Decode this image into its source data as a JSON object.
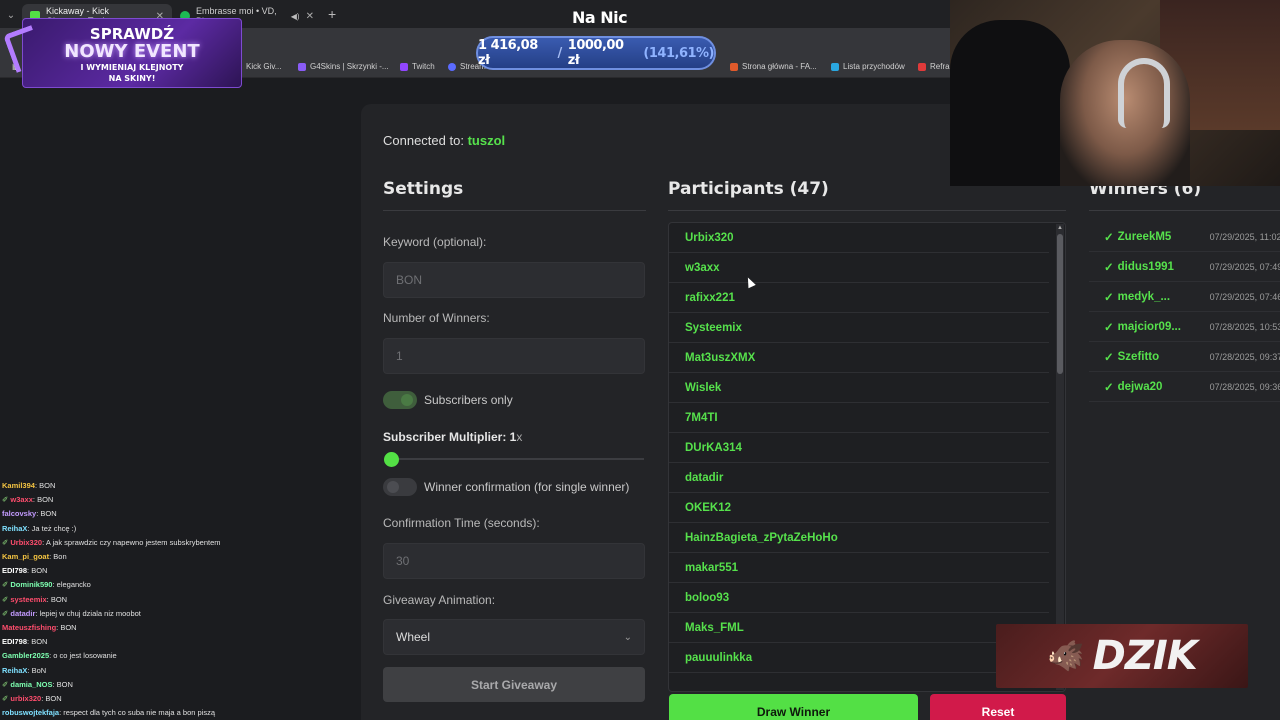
{
  "browser": {
    "tabs": [
      {
        "title": "Kickaway - Kick Giveaway Tool",
        "active": true,
        "color": "#53e045"
      },
      {
        "title": "Embrasse moi • VD, Bleue",
        "active": false,
        "color": "#1db954"
      }
    ],
    "bookmarks": [
      {
        "label": "Kick Giv..."
      },
      {
        "label": "G4Skins | Skrzynki -..."
      },
      {
        "label": "Twitch"
      },
      {
        "label": "Stream"
      },
      {
        "label": "Strona główna - FA..."
      },
      {
        "label": "Lista przychodów"
      },
      {
        "label": "Refra"
      }
    ]
  },
  "overlay": {
    "channel_title": "Na Nic",
    "promo": {
      "line1": "SPRAWDŹ",
      "line2": "NOWY EVENT",
      "line3": "I WYMIENIAJ KLEJNOTY",
      "line4": "NA SKINY!"
    },
    "money": {
      "current": "1 416,08 zł",
      "separator": "/",
      "goal": "1000,00 zł",
      "percent": "(141,61%)"
    },
    "sponsor": "DZIK"
  },
  "app": {
    "connected_label": "Connected to:",
    "connected_user": "tuszol",
    "settings": {
      "title": "Settings",
      "keyword_label": "Keyword (optional):",
      "keyword_placeholder": "BON",
      "winners_label": "Number of Winners:",
      "winners_placeholder": "1",
      "subscribers_only_label": "Subscribers only",
      "subscribers_only": true,
      "multiplier_label": "Subscriber Multiplier: 1",
      "multiplier_suffix": "x",
      "multiplier_value": 1,
      "winner_confirmation_label": "Winner confirmation (for single winner)",
      "winner_confirmation": false,
      "confirmation_time_label": "Confirmation Time (seconds):",
      "confirmation_time_placeholder": "30",
      "animation_label": "Giveaway Animation:",
      "animation_value": "Wheel",
      "start_button": "Start Giveaway"
    },
    "participants": {
      "title": "Participants (47)",
      "items": [
        "Urbix320",
        "w3axx",
        "rafixx221",
        "Systeemix",
        "Mat3uszXMX",
        "Wislek",
        "7M4TI",
        "DUrKA314",
        "datadir",
        "OKEK12",
        "HainzBagieta_zPytaZeHoHo",
        "makar551",
        "boloo93",
        "Maks_FML",
        "pauuulinkka"
      ],
      "draw_button": "Draw Winner",
      "reset_button": "Reset"
    },
    "winners": {
      "title": "Winners (6)",
      "items": [
        {
          "name": "ZureekM5",
          "time": "07/29/2025, 11:02"
        },
        {
          "name": "didus1991",
          "time": "07/29/2025, 07:49"
        },
        {
          "name": "medyk_...",
          "time": "07/29/2025, 07:46"
        },
        {
          "name": "majcior09...",
          "time": "07/28/2025, 10:53"
        },
        {
          "name": "Szefitto",
          "time": "07/28/2025, 09:37"
        },
        {
          "name": "dejwa20",
          "time": "07/28/2025, 09:36"
        }
      ],
      "check": "✓"
    }
  },
  "chat": [
    {
      "user": "Kamil394",
      "color": "#f5c542",
      "msg": "BON",
      "icon": false
    },
    {
      "user": "w3axx",
      "color": "#ff4d6d",
      "msg": "BON",
      "icon": true
    },
    {
      "user": "falcovsky",
      "color": "#c39bff",
      "msg": "BON",
      "icon": false
    },
    {
      "user": "ReihaX",
      "color": "#7fe0ff",
      "msg": "Ja też chcę :)",
      "icon": false
    },
    {
      "user": "Urbix320",
      "color": "#ff4d6d",
      "msg": "A jak sprawdzic czy napewno jestem subskrybentem",
      "icon": true
    },
    {
      "user": "Kam_pi_goat",
      "color": "#f5c542",
      "msg": "Bon",
      "icon": false
    },
    {
      "user": "EDI798",
      "color": "#ffffff",
      "msg": "BON",
      "icon": false
    },
    {
      "user": "Dominik590",
      "color": "#7dffb0",
      "msg": "elegancko",
      "icon": true
    },
    {
      "user": "systeemix",
      "color": "#ff4d6d",
      "msg": "BON",
      "icon": true
    },
    {
      "user": "datadir",
      "color": "#c39bff",
      "msg": "lepiej w chuj dziala niz moobot",
      "icon": true
    },
    {
      "user": "Mateuszfishing",
      "color": "#ff4d6d",
      "msg": "BON",
      "icon": false
    },
    {
      "user": "EDI798",
      "color": "#ffffff",
      "msg": "BON",
      "icon": false
    },
    {
      "user": "Gambler2025",
      "color": "#7dffb0",
      "msg": "o co jest losowanie",
      "icon": false
    },
    {
      "user": "ReihaX",
      "color": "#7fe0ff",
      "msg": "BoN",
      "icon": false
    },
    {
      "user": "damia_NOS",
      "color": "#7dffb0",
      "msg": "BON",
      "icon": true
    },
    {
      "user": "urbix320",
      "color": "#ff4d6d",
      "msg": "BON",
      "icon": true
    },
    {
      "user": "robuswojtekfaja",
      "color": "#7fe0ff",
      "msg": "respect dla tych co suba nie maja a bon piszą",
      "icon": false
    }
  ]
}
